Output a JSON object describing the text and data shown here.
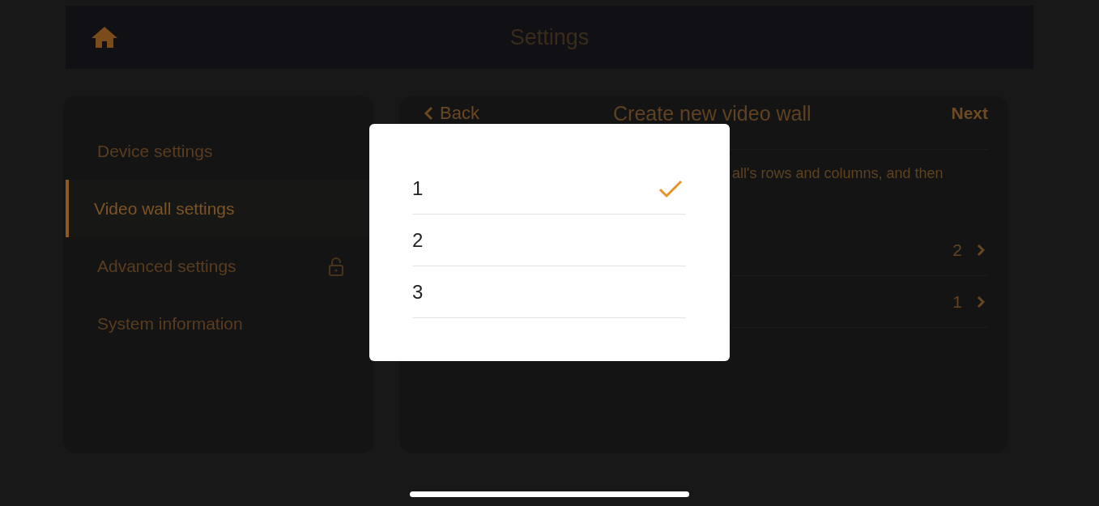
{
  "header": {
    "title": "Settings"
  },
  "sidebar": {
    "items": [
      {
        "label": "Device settings",
        "selected": false,
        "locked": false
      },
      {
        "label": "Video wall settings",
        "selected": true,
        "locked": false
      },
      {
        "label": "Advanced settings",
        "selected": false,
        "locked": true
      },
      {
        "label": "System information",
        "selected": false,
        "locked": false
      }
    ]
  },
  "panel": {
    "back": "Back",
    "title": "Create new video wall",
    "next": "Next",
    "description": "all's rows and columns, and then",
    "rows": [
      {
        "value": "2"
      },
      {
        "value": "1"
      }
    ]
  },
  "picker": {
    "options": [
      {
        "label": "1",
        "selected": true
      },
      {
        "label": "2",
        "selected": false
      },
      {
        "label": "3",
        "selected": false
      }
    ]
  }
}
